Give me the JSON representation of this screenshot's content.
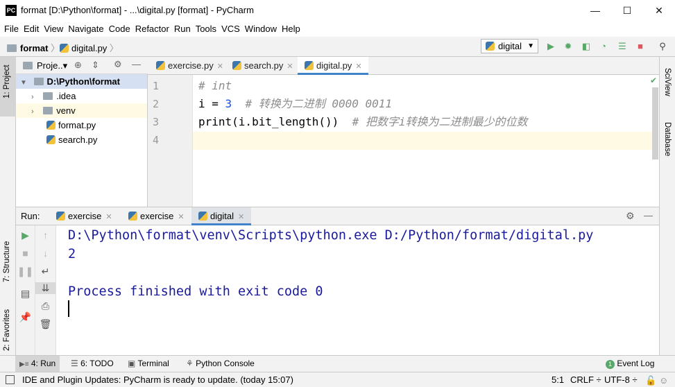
{
  "window": {
    "title": "format [D:\\Python\\format] - ...\\digital.py [format] - PyCharm",
    "logo_text": "PC",
    "controls": {
      "minimize": "—",
      "maximize": "☐",
      "close": "✕"
    }
  },
  "menu": [
    {
      "label": "File"
    },
    {
      "label": "Edit"
    },
    {
      "label": "View"
    },
    {
      "label": "Navigate"
    },
    {
      "label": "Code"
    },
    {
      "label": "Refactor"
    },
    {
      "label": "Run"
    },
    {
      "label": "Tools"
    },
    {
      "label": "VCS"
    },
    {
      "label": "Window"
    },
    {
      "label": "Help"
    }
  ],
  "breadcrumb": {
    "project": "format",
    "file": "digital.py"
  },
  "run_config": {
    "selected": "digital"
  },
  "left_strip": {
    "project_tab": "1: Project",
    "structure_tab": "7: Structure",
    "favorites_tab": "2: Favorites"
  },
  "right_strip": {
    "sciview": "SciView",
    "database": "Database"
  },
  "project_panel": {
    "title": "Proje..▾",
    "tree": [
      {
        "label": "D:\\Python\\format",
        "kind": "root"
      },
      {
        "label": ".idea",
        "kind": "folder"
      },
      {
        "label": "venv",
        "kind": "folder"
      },
      {
        "label": "format.py",
        "kind": "file"
      },
      {
        "label": "search.py",
        "kind": "file"
      }
    ]
  },
  "editor": {
    "tabs": [
      {
        "label": "exercise.py"
      },
      {
        "label": "search.py"
      },
      {
        "label": "digital.py",
        "active": true
      }
    ],
    "line_numbers": [
      "1",
      "2",
      "3",
      "4"
    ],
    "lines": {
      "l1_comment": "# int",
      "l2_code": "i = ",
      "l2_num": "3",
      "l2_comment": "# 转换为二进制 0000 0011",
      "l3_code": "print(i.bit_length())",
      "l3_comment": "# 把数字i转换为二进制最少的位数"
    }
  },
  "run_panel": {
    "label": "Run:",
    "tabs": [
      {
        "label": "exercise"
      },
      {
        "label": "exercise"
      },
      {
        "label": "digital",
        "active": true
      }
    ],
    "output": [
      "D:\\Python\\format\\venv\\Scripts\\python.exe D:/Python/format/digital.py",
      "2",
      "",
      "Process finished with exit code 0"
    ]
  },
  "bottom_tabs": {
    "run": "4: Run",
    "todo": "6: TODO",
    "terminal": "Terminal",
    "python_console": "Python Console",
    "event_log": "Event Log",
    "event_log_count": "1"
  },
  "status": {
    "message": "IDE and Plugin Updates: PyCharm is ready to update. (today 15:07)",
    "position": "5:1",
    "line_sep": "CRLF ÷",
    "encoding": "UTF-8 ÷"
  },
  "colors": {
    "accent": "#4083c9",
    "run_green": "#59a869",
    "stop_red": "#db5860",
    "current_line": "#fffae3",
    "console_text": "#1a1a9c"
  }
}
